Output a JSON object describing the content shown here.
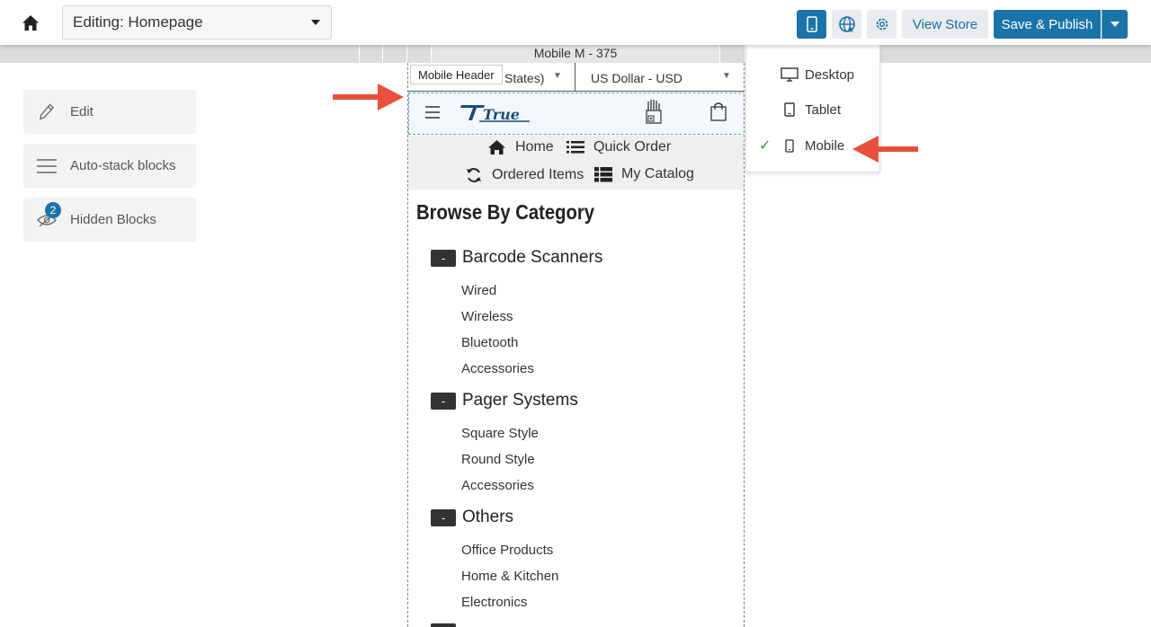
{
  "topbar": {
    "page_select_value": "Editing: Homepage",
    "view_store_label": "View Store",
    "publish_label": "Save & Publish"
  },
  "ruler": {
    "label": "Mobile M - 375"
  },
  "sidebar": {
    "items": [
      {
        "label": "Edit",
        "icon": "pencil-icon"
      },
      {
        "label": "Auto-stack blocks",
        "icon": "menu-lines-icon"
      },
      {
        "label": "Hidden Blocks",
        "icon": "hidden-eye-icon",
        "badge": "2"
      }
    ]
  },
  "preview": {
    "header_tag": "Mobile Header",
    "language_text": "States)",
    "currency_text": "US Dollar - USD",
    "logo_text": "True",
    "nav": {
      "home": "Home",
      "quick_order": "Quick Order",
      "ordered_items": "Ordered Items",
      "my_catalog": "My Catalog"
    },
    "browse_title": "Browse By Category",
    "categories": [
      {
        "name": "Barcode Scanners",
        "toggle": "-",
        "items": [
          "Wired",
          "Wireless",
          "Bluetooth",
          "Accessories"
        ]
      },
      {
        "name": "Pager Systems",
        "toggle": "-",
        "items": [
          "Square Style",
          "Round Style",
          "Accessories"
        ]
      },
      {
        "name": "Others",
        "toggle": "-",
        "items": [
          "Office Products",
          "Home & Kitchen",
          "Electronics"
        ]
      }
    ]
  },
  "device_menu": {
    "items": [
      {
        "label": "Desktop",
        "icon": "desktop-icon",
        "selected": false
      },
      {
        "label": "Tablet",
        "icon": "tablet-icon",
        "selected": false
      },
      {
        "label": "Mobile",
        "icon": "mobile-icon",
        "selected": true
      }
    ],
    "check_glyph": "✓"
  },
  "colors": {
    "accent": "#1b74a8",
    "annotation_arrow": "#e8503e",
    "check": "#2e9e2e"
  }
}
